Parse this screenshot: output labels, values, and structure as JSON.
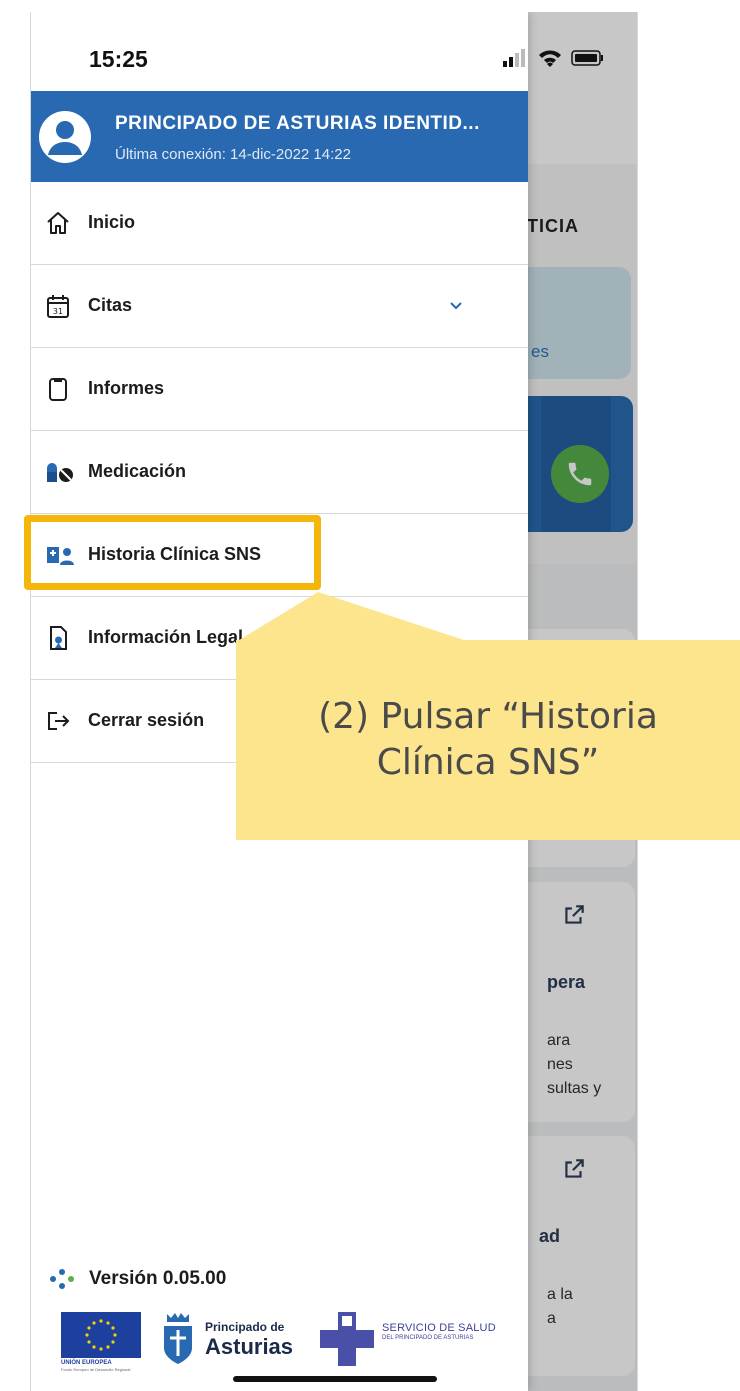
{
  "status_bar": {
    "time": "15:25"
  },
  "profile": {
    "name": "PRINCIPADO DE ASTURIAS IDENTID...",
    "last_connection": "Última conexión: 14-dic-2022 14:22"
  },
  "menu": {
    "items": [
      {
        "label": "Inicio",
        "icon": "home-icon"
      },
      {
        "label": "Citas",
        "icon": "calendar-icon",
        "expandable": true
      },
      {
        "label": "Informes",
        "icon": "clipboard-icon"
      },
      {
        "label": "Medicación",
        "icon": "pills-icon"
      },
      {
        "label": "Historia Clínica SNS",
        "icon": "medical-record-icon"
      },
      {
        "label": "Información Legal",
        "icon": "legal-document-icon"
      },
      {
        "label": "Cerrar sesión",
        "icon": "logout-icon"
      }
    ]
  },
  "version": {
    "label": "Versión 0.05.00"
  },
  "logos": {
    "eu": {
      "label": "UNIÓN EUROPEA",
      "sub": "Fondo Europeo de Desarrollo Regional"
    },
    "asturias": {
      "small": "Principado de",
      "big": "Asturias"
    },
    "sespa": {
      "name": "SERVICIO DE SALUD",
      "sub": "DEL PRINCIPADO DE ASTURIAS"
    }
  },
  "background": {
    "section_title_fragment": "TICIA",
    "card1_link_fragment": "es",
    "card4_title_fragment": "pera",
    "card4_text_fragments": [
      "ara",
      "nes",
      "sultas y"
    ],
    "card5_title_fragment": "ad",
    "card5_text_fragments": [
      "a la",
      "a"
    ]
  },
  "annotation": {
    "callout_text": "(2) Pulsar “Historia Clínica SNS”"
  },
  "colors": {
    "header_blue": "#2869b2",
    "highlight": "#f4b60a",
    "callout": "#fde58e",
    "call_green": "#58b04c"
  }
}
